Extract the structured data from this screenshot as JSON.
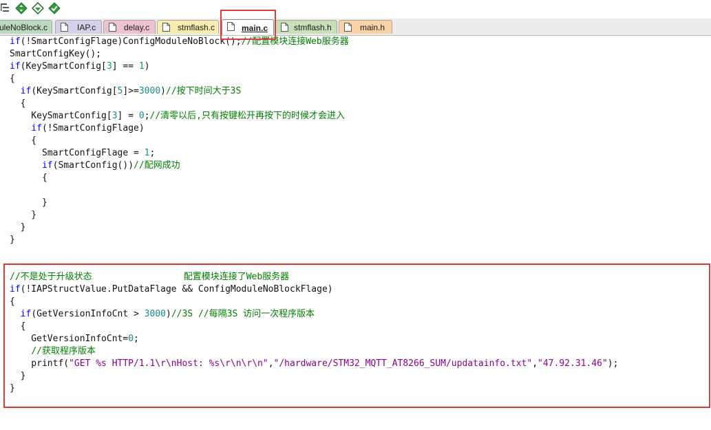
{
  "toolbar": {
    "icons": [
      "indent-icon",
      "diamond-arrows-icon",
      "diamond-down-icon",
      "diamond-check-icon"
    ]
  },
  "tabs": [
    {
      "label": "uleNoBlock.c",
      "color": "#b9d9c0"
    },
    {
      "label": "IAP.c",
      "color": "#d7d0ea"
    },
    {
      "label": "delay.c",
      "color": "#eec3cf"
    },
    {
      "label": "stmflash.c",
      "color": "#f7ecad"
    },
    {
      "label": "main.c",
      "color": "#ffffff",
      "active": true
    },
    {
      "label": "stmflash.h",
      "color": "#c9dfb8"
    },
    {
      "label": "main.h",
      "color": "#f9d2a6"
    }
  ],
  "colors": {
    "keyword": "#0000ff",
    "number": "#1a8a8a",
    "comment": "#008000",
    "string": "#8b008b",
    "highlight": "#e03a3a"
  },
  "code": {
    "lines": [
      [
        [
          "kw",
          "if"
        ],
        [
          "t",
          "(!SmartConfigFlage)ConfigModuleNoBlock();"
        ],
        [
          "cm",
          "//配置模块连接Web服务器"
        ]
      ],
      [
        [
          "t",
          "SmartConfigKey();"
        ]
      ],
      [
        [
          "kw",
          "if"
        ],
        [
          "t",
          "(KeySmartConfig["
        ],
        [
          "num",
          "3"
        ],
        [
          "t",
          "] == "
        ],
        [
          "num",
          "1"
        ],
        [
          "t",
          ")"
        ]
      ],
      [
        [
          "t",
          "{"
        ]
      ],
      [
        [
          "t",
          "  "
        ],
        [
          "kw",
          "if"
        ],
        [
          "t",
          "(KeySmartConfig["
        ],
        [
          "num",
          "5"
        ],
        [
          "t",
          "]>="
        ],
        [
          "num",
          "3000"
        ],
        [
          "t",
          ")"
        ],
        [
          "cm",
          "//按下时间大于3S"
        ]
      ],
      [
        [
          "t",
          "  {"
        ]
      ],
      [
        [
          "t",
          "    KeySmartConfig["
        ],
        [
          "num",
          "3"
        ],
        [
          "t",
          "] = "
        ],
        [
          "num",
          "0"
        ],
        [
          "t",
          ";"
        ],
        [
          "cm",
          "//清零以后,只有按键松开再按下的时候才会进入"
        ]
      ],
      [
        [
          "t",
          "    "
        ],
        [
          "kw",
          "if"
        ],
        [
          "t",
          "(!SmartConfigFlage)"
        ]
      ],
      [
        [
          "t",
          "    {"
        ]
      ],
      [
        [
          "t",
          "      SmartConfigFlage = "
        ],
        [
          "num",
          "1"
        ],
        [
          "t",
          ";"
        ]
      ],
      [
        [
          "t",
          "      "
        ],
        [
          "kw",
          "if"
        ],
        [
          "t",
          "(SmartConfig())"
        ],
        [
          "cm",
          "//配网成功"
        ]
      ],
      [
        [
          "t",
          "      {"
        ]
      ],
      [
        [
          "t",
          ""
        ]
      ],
      [
        [
          "t",
          "      }"
        ]
      ],
      [
        [
          "t",
          "    }"
        ]
      ],
      [
        [
          "t",
          "  }"
        ]
      ],
      [
        [
          "t",
          "}"
        ]
      ],
      [
        [
          "t",
          ""
        ]
      ],
      [
        [
          "t",
          ""
        ]
      ],
      [
        [
          "cm",
          "//不是处于升级状态                 配置模块连接了Web服务器"
        ]
      ],
      [
        [
          "kw",
          "if"
        ],
        [
          "t",
          "(!IAPStructValue.PutDataFlage && ConfigModuleNoBlockFlage)"
        ]
      ],
      [
        [
          "t",
          "{"
        ]
      ],
      [
        [
          "t",
          "  "
        ],
        [
          "kw",
          "if"
        ],
        [
          "t",
          "(GetVersionInfoCnt > "
        ],
        [
          "num",
          "3000"
        ],
        [
          "t",
          ")"
        ],
        [
          "cm",
          "//3S //每隔3S 访问一次程序版本"
        ]
      ],
      [
        [
          "t",
          "  {"
        ]
      ],
      [
        [
          "t",
          "    GetVersionInfoCnt="
        ],
        [
          "num",
          "0"
        ],
        [
          "t",
          ";"
        ]
      ],
      [
        [
          "t",
          "    "
        ],
        [
          "cm",
          "//获取程序版本"
        ]
      ],
      [
        [
          "t",
          "    printf("
        ],
        [
          "str",
          "\"GET %s HTTP/1.1\\r\\nHost: %s\\r\\n\\r\\n\""
        ],
        [
          "t",
          ","
        ],
        [
          "str",
          "\"/hardware/STM32_MQTT_AT8266_SUM/updatainfo.txt\""
        ],
        [
          "t",
          ","
        ],
        [
          "str",
          "\"47.92.31.46\""
        ],
        [
          "t",
          ");"
        ]
      ],
      [
        [
          "t",
          "  }"
        ]
      ],
      [
        [
          "t",
          "}"
        ]
      ]
    ]
  }
}
